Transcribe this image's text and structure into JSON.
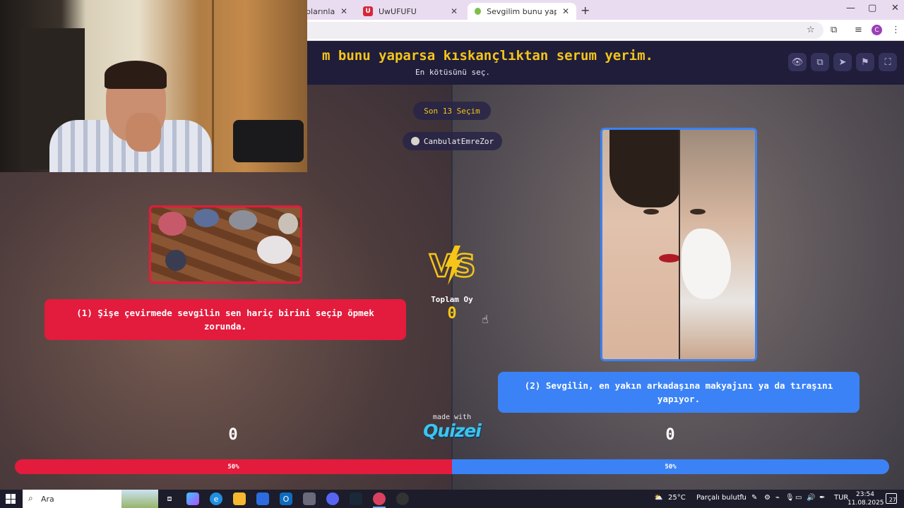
{
  "browser": {
    "tabs": [
      {
        "label": "ıplarınla Onli",
        "icon": "generic"
      },
      {
        "label": "UwUFUFU",
        "icon": "U"
      },
      {
        "label": "Sevgilim bunu yaparsa kıskanç",
        "icon": "quizei-leaf"
      }
    ],
    "new_tab": "+",
    "window_controls": {
      "minimize": "—",
      "maximize": "▢",
      "close": "✕"
    },
    "profile_initial": "C"
  },
  "quiz": {
    "title": "m bunu yaparsa kıskançlıktan serum yerim.",
    "subtitle": "En kötüsünü seç.",
    "header_icons": [
      "eye-icon",
      "copy-icon",
      "send-icon",
      "flag-icon",
      "fullscreen-icon"
    ],
    "round_badge": "Son 13 Seçim",
    "user": "CanbulatEmreZor",
    "total_label": "Toplam Oy",
    "total_votes": "0",
    "options": [
      {
        "label": "(1) Şişe çevirmede sevgilin sen hariç birini seçip öpmek zorunda.",
        "votes": "0",
        "percent_label": "50%",
        "percent": 50,
        "color": "#e31b3c"
      },
      {
        "label": "(2) Sevgilin, en yakın arkadaşına makyajını ya da tıraşını yapıyor.",
        "votes": "0",
        "percent_label": "50%",
        "percent": 50,
        "color": "#3b82f6"
      }
    ],
    "made_with": "made with",
    "brand": "QUIZEI",
    "accent": "#f5c518"
  },
  "taskbar": {
    "search_placeholder": "Ara",
    "weather_temp": "25°C",
    "weather_desc": "Parçalı bulutlu",
    "language": "TUR",
    "time": "23:54",
    "date": "11.08.2025",
    "notifications": "27"
  }
}
